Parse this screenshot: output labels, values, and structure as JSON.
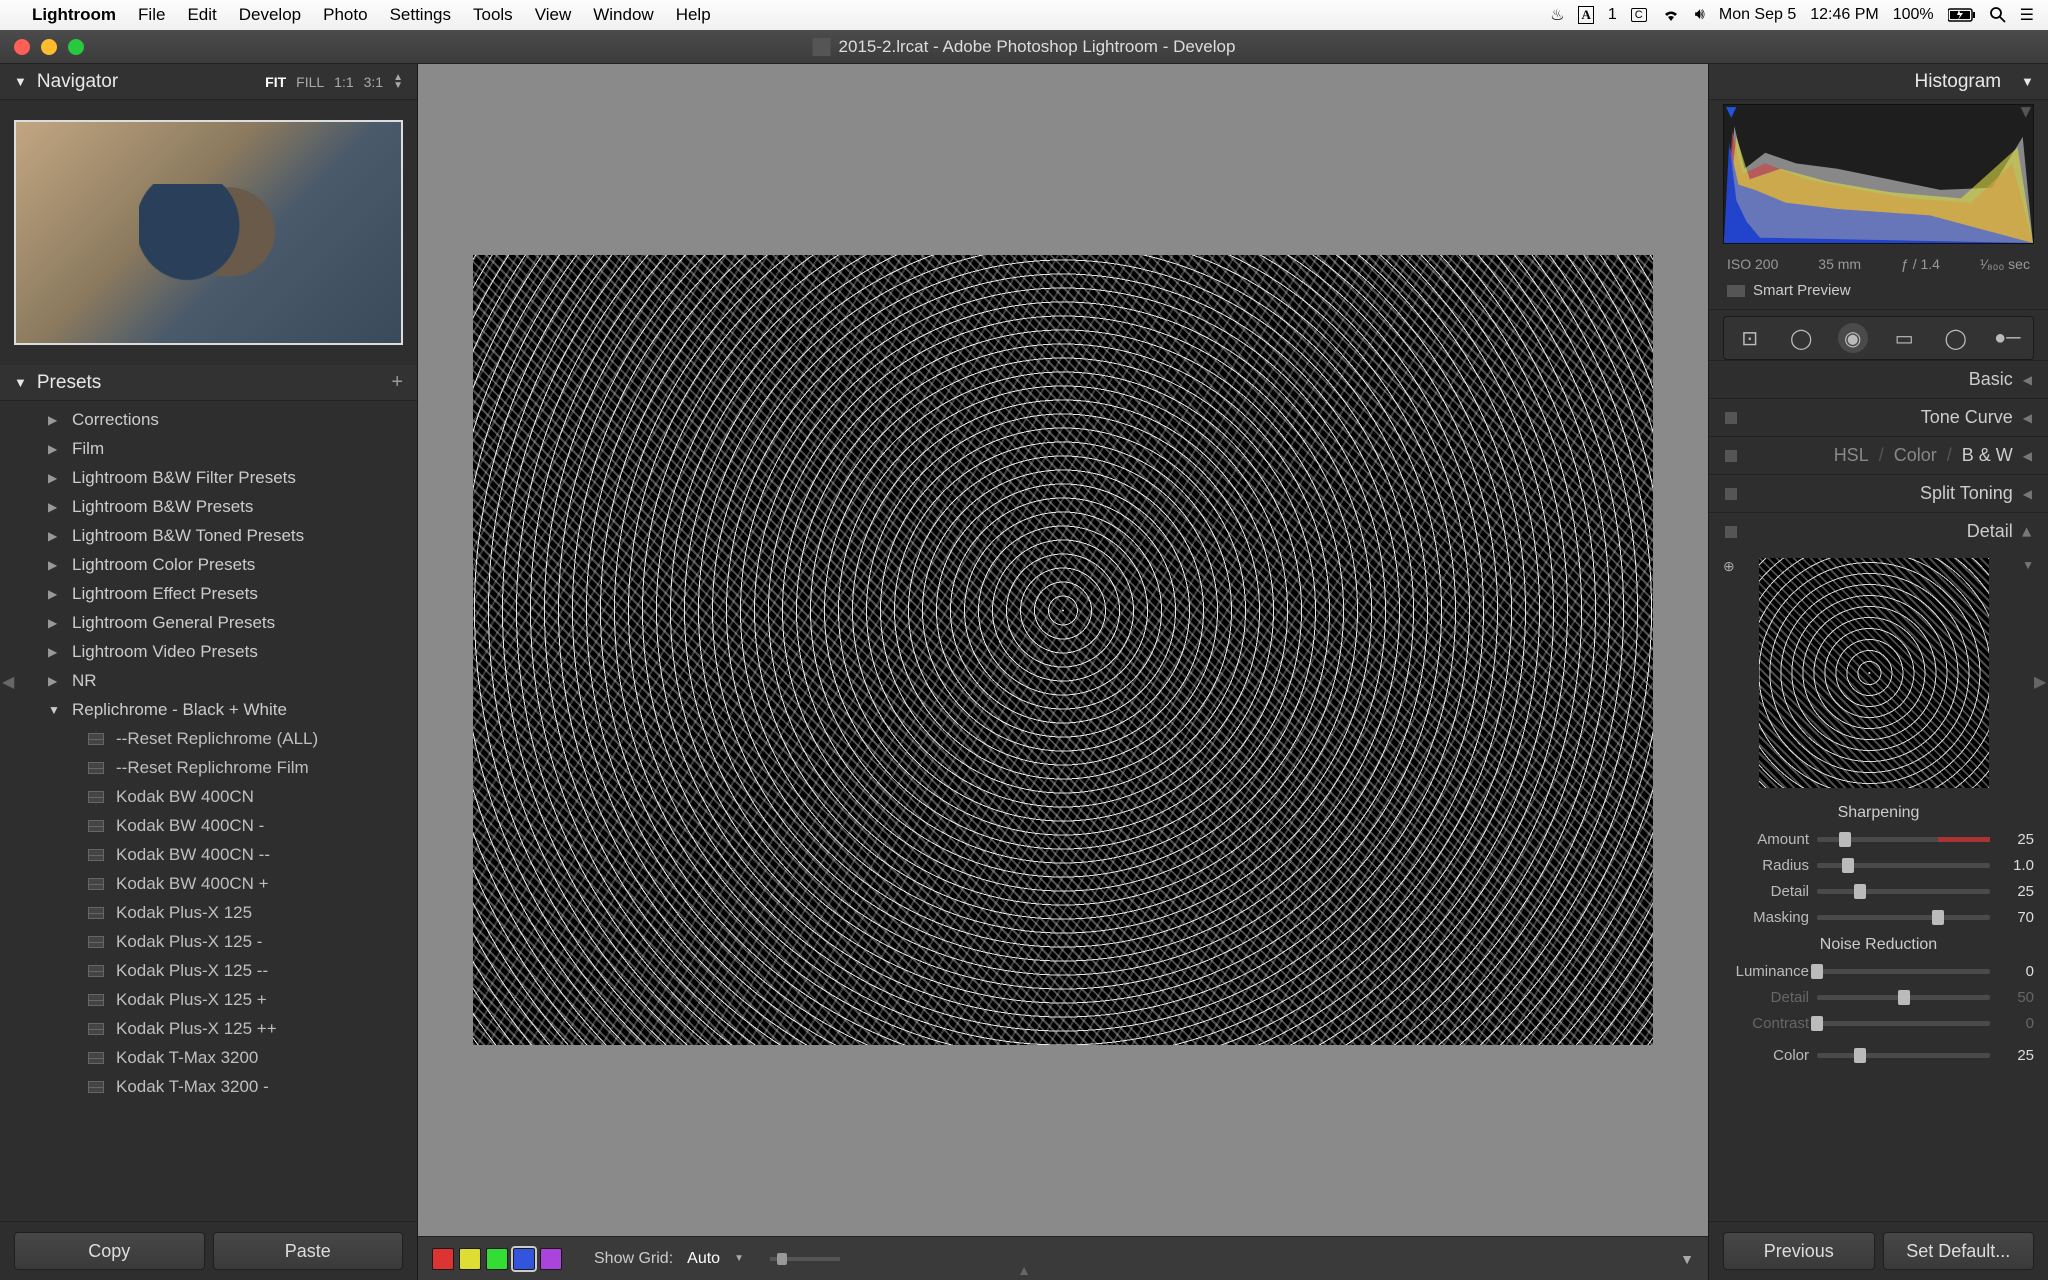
{
  "menubar": {
    "app": "Lightroom",
    "items": [
      "File",
      "Edit",
      "Develop",
      "Photo",
      "Settings",
      "Tools",
      "View",
      "Window",
      "Help"
    ],
    "status": {
      "a1": "1",
      "day": "Mon Sep 5",
      "time": "12:46 PM",
      "battery": "100%"
    }
  },
  "window": {
    "title": "2015-2.lrcat - Adobe Photoshop Lightroom - Develop"
  },
  "navigator": {
    "title": "Navigator",
    "zoom_options": [
      "FIT",
      "FILL",
      "1:1",
      "3:1"
    ],
    "active_zoom": "FIT"
  },
  "presets": {
    "title": "Presets",
    "folders": [
      {
        "label": "Corrections",
        "expanded": false
      },
      {
        "label": "Film",
        "expanded": false
      },
      {
        "label": "Lightroom B&W Filter Presets",
        "expanded": false
      },
      {
        "label": "Lightroom B&W Presets",
        "expanded": false
      },
      {
        "label": "Lightroom B&W Toned Presets",
        "expanded": false
      },
      {
        "label": "Lightroom Color Presets",
        "expanded": false
      },
      {
        "label": "Lightroom Effect Presets",
        "expanded": false
      },
      {
        "label": "Lightroom General Presets",
        "expanded": false
      },
      {
        "label": "Lightroom Video Presets",
        "expanded": false
      },
      {
        "label": "NR",
        "expanded": false
      },
      {
        "label": "Replichrome - Black + White",
        "expanded": true,
        "items": [
          "--Reset Replichrome (ALL)",
          "--Reset Replichrome Film",
          "Kodak BW 400CN",
          "Kodak BW 400CN -",
          "Kodak BW 400CN --",
          "Kodak BW 400CN +",
          "Kodak Plus-X 125",
          "Kodak Plus-X 125 -",
          "Kodak Plus-X 125 --",
          "Kodak Plus-X 125 +",
          "Kodak Plus-X 125 ++",
          "Kodak T-Max 3200",
          "Kodak T-Max 3200 -"
        ]
      }
    ]
  },
  "left_buttons": {
    "copy": "Copy",
    "paste": "Paste"
  },
  "center_bottom": {
    "grid_label": "Show Grid:",
    "grid_value": "Auto"
  },
  "histogram": {
    "title": "Histogram",
    "iso": "ISO 200",
    "focal": "35 mm",
    "aperture": "ƒ / 1.4",
    "shutter": "¹⁄₈₀₀ sec",
    "smart_preview": "Smart Preview"
  },
  "sections": {
    "basic": "Basic",
    "tone_curve": "Tone Curve",
    "hsl": "HSL",
    "color": "Color",
    "bw": "B & W",
    "split_toning": "Split Toning",
    "detail": "Detail"
  },
  "detail": {
    "sharpening_label": "Sharpening",
    "sliders_sharp": [
      {
        "label": "Amount",
        "value": "25",
        "pos": 16,
        "track": "red-right"
      },
      {
        "label": "Radius",
        "value": "1.0",
        "pos": 18
      },
      {
        "label": "Detail",
        "value": "25",
        "pos": 25
      },
      {
        "label": "Masking",
        "value": "70",
        "pos": 70
      }
    ],
    "nr_label": "Noise Reduction",
    "sliders_nr": [
      {
        "label": "Luminance",
        "value": "0",
        "pos": 0
      },
      {
        "label": "Detail",
        "value": "50",
        "pos": 50,
        "muted": true
      },
      {
        "label": "Contrast",
        "value": "0",
        "pos": 0,
        "muted": true
      }
    ],
    "color_slider": {
      "label": "Color",
      "value": "25",
      "pos": 25
    }
  },
  "right_buttons": {
    "previous": "Previous",
    "set_default": "Set Default..."
  }
}
